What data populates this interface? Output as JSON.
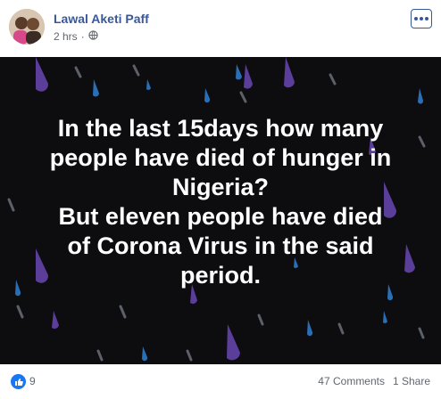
{
  "post": {
    "author": "Lawal Aketi Paff",
    "time": "2 hrs",
    "privacy_separator": "·",
    "privacy_icon": "globe-icon",
    "text_lines": [
      "In the last 15days how many",
      "people have died of hunger in",
      "Nigeria?",
      "But eleven people have died",
      "of Corona Virus in the said",
      "period."
    ]
  },
  "footer": {
    "reaction_icon": "like-icon",
    "reaction_count": "9",
    "comments": "47 Comments",
    "shares": "1 Share"
  },
  "colors": {
    "name": "#385898",
    "background": "#0d0d10",
    "drop_blue": "#2a6fb5",
    "drop_purple": "#5b3d9a",
    "drop_gray": "#5c6068",
    "like_blue": "#1877f2"
  }
}
